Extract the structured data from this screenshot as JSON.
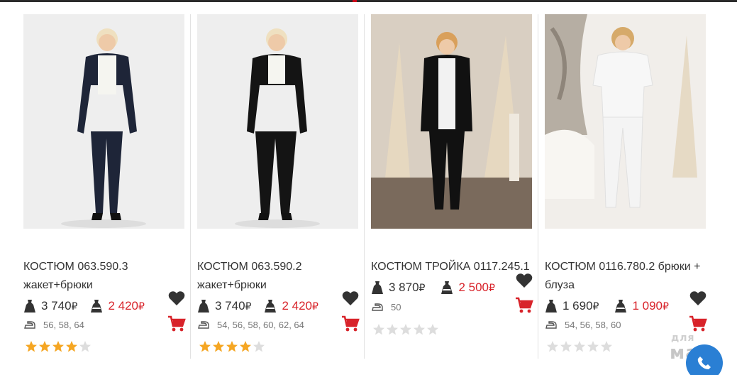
{
  "products": [
    {
      "title": "КОСТЮМ 063.590.3 жакет+брюки",
      "old_price": "3 740",
      "sale_price": "2 420",
      "currency": "₽",
      "sizes": "56, 58, 64",
      "rating": 4,
      "rating_max": 5,
      "suit_color": "#1e2538"
    },
    {
      "title": "КОСТЮМ 063.590.2 жакет+брюки",
      "old_price": "3 740",
      "sale_price": "2 420",
      "currency": "₽",
      "sizes": "54, 56, 58, 60, 62, 64",
      "rating": 4,
      "rating_max": 5,
      "suit_color": "#141414"
    },
    {
      "title": "КОСТЮМ ТРОЙКА 0117.245.1",
      "old_price": "3 870",
      "sale_price": "2 500",
      "currency": "₽",
      "sizes": "50",
      "rating": 0,
      "rating_max": 5,
      "suit_color": "#111111"
    },
    {
      "title": "КОСТЮМ 0116.780.2 брюки + блуза",
      "old_price": "1 690",
      "sale_price": "1 090",
      "currency": "₽",
      "sizes": "54, 56, 58, 60",
      "rating": 0,
      "rating_max": 5,
      "suit_color": "#f2f2f2"
    }
  ],
  "colors": {
    "sale": "#d8232a",
    "star_on": "#f5a623",
    "star_off": "#dddddd",
    "heart": "#333333",
    "cart": "#d8232a",
    "chat": "#2a7fd4"
  },
  "icons": {
    "old_price": "dress-icon",
    "sale_price": "dress-sale-icon",
    "sizes": "iron-icon",
    "wishlist": "heart-icon",
    "cart": "cart-icon",
    "rating": "star-icon",
    "chat": "phone-icon"
  },
  "watermark": {
    "line1": "для",
    "line2": "мам"
  }
}
